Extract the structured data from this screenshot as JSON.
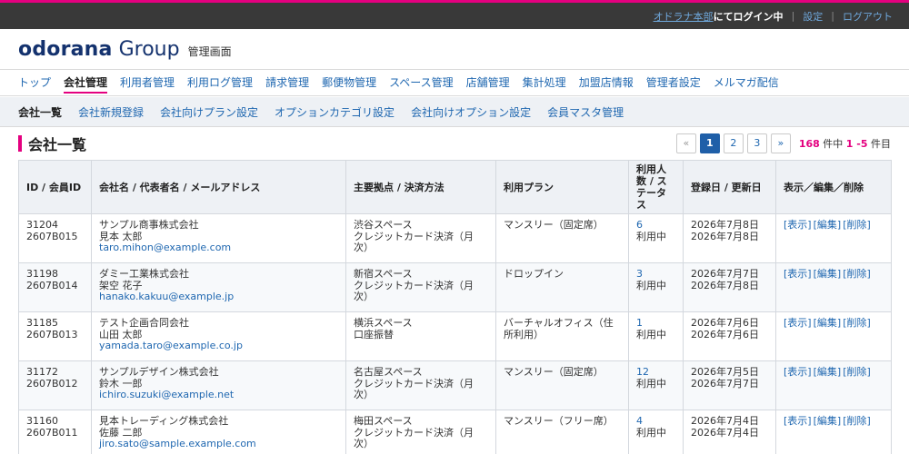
{
  "topbar": {
    "org_link": "オドラナ本部",
    "login_suffix": "にてログイン中",
    "settings": "設定",
    "logout": "ログアウト"
  },
  "brand": {
    "name": "odorana",
    "group": "Group",
    "subtitle": "管理画面"
  },
  "main_nav": [
    {
      "label": "トップ",
      "active": false
    },
    {
      "label": "会社管理",
      "active": true
    },
    {
      "label": "利用者管理",
      "active": false
    },
    {
      "label": "利用ログ管理",
      "active": false
    },
    {
      "label": "請求管理",
      "active": false
    },
    {
      "label": "郵便物管理",
      "active": false
    },
    {
      "label": "スペース管理",
      "active": false
    },
    {
      "label": "店舗管理",
      "active": false
    },
    {
      "label": "集計処理",
      "active": false
    },
    {
      "label": "加盟店情報",
      "active": false
    },
    {
      "label": "管理者設定",
      "active": false
    },
    {
      "label": "メルマガ配信",
      "active": false
    }
  ],
  "sub_nav": [
    {
      "label": "会社一覧",
      "active": true
    },
    {
      "label": "会社新規登録",
      "active": false
    },
    {
      "label": "会社向けプラン設定",
      "active": false
    },
    {
      "label": "オプションカテゴリ設定",
      "active": false
    },
    {
      "label": "会社向けオプション設定",
      "active": false
    },
    {
      "label": "会員マスタ管理",
      "active": false
    }
  ],
  "page": {
    "title": "会社一覧"
  },
  "pagination": {
    "prev": "«",
    "pages": [
      "1",
      "2",
      "3"
    ],
    "current": "1",
    "next": "»",
    "total": "168",
    "total_suffix": "件中",
    "range": "1 -5",
    "range_suffix": "件目"
  },
  "table": {
    "headers": {
      "id": "ID / 会員ID",
      "company": "会社名 / 代表者名 / メールアドレス",
      "location": "主要拠点 / 決済方法",
      "plan": "利用プラン",
      "users": "利用人数 / ステータス",
      "dates": "登録日 / 更新日",
      "actions": "表示／編集／削除"
    },
    "action_labels": {
      "view": "[表示]",
      "edit": "[編集]",
      "del": "[削除]"
    },
    "rows": [
      {
        "id": "31204",
        "member_id": "2607B015",
        "company": "サンプル商事株式会社",
        "rep": "見本 太郎",
        "email": "taro.mihon@example.com",
        "location": "渋谷スペース",
        "payment": "クレジットカード決済（月次）",
        "plan": "マンスリー（固定席）",
        "users": "6",
        "status": "利用中",
        "registered": "2026年7月8日",
        "updated": "2026年7月8日"
      },
      {
        "id": "31198",
        "member_id": "2607B014",
        "company": "ダミー工業株式会社",
        "rep": "架空 花子",
        "email": "hanako.kakuu@example.jp",
        "location": "新宿スペース",
        "payment": "クレジットカード決済（月次）",
        "plan": "ドロップイン",
        "users": "3",
        "status": "利用中",
        "registered": "2026年7月7日",
        "updated": "2026年7月8日"
      },
      {
        "id": "31185",
        "member_id": "2607B013",
        "company": "テスト企画合同会社",
        "rep": "山田 太郎",
        "email": "yamada.taro@example.co.jp",
        "location": "横浜スペース",
        "payment": "口座振替",
        "plan": "バーチャルオフィス（住所利用）",
        "users": "1",
        "status": "利用中",
        "registered": "2026年7月6日",
        "updated": "2026年7月6日"
      },
      {
        "id": "31172",
        "member_id": "2607B012",
        "company": "サンプルデザイン株式会社",
        "rep": "鈴木 一郎",
        "email": "ichiro.suzuki@example.net",
        "location": "名古屋スペース",
        "payment": "クレジットカード決済（月次）",
        "plan": "マンスリー（固定席）",
        "users": "12",
        "status": "利用中",
        "registered": "2026年7月5日",
        "updated": "2026年7月7日"
      },
      {
        "id": "31160",
        "member_id": "2607B011",
        "company": "見本トレーディング株式会社",
        "rep": "佐藤 二郎",
        "email": "jiro.sato@sample.example.com",
        "location": "梅田スペース",
        "payment": "クレジットカード決済（月次）",
        "plan": "マンスリー（フリー席）",
        "users": "4",
        "status": "利用中",
        "registered": "2026年7月4日",
        "updated": "2026年7月4日"
      }
    ]
  }
}
